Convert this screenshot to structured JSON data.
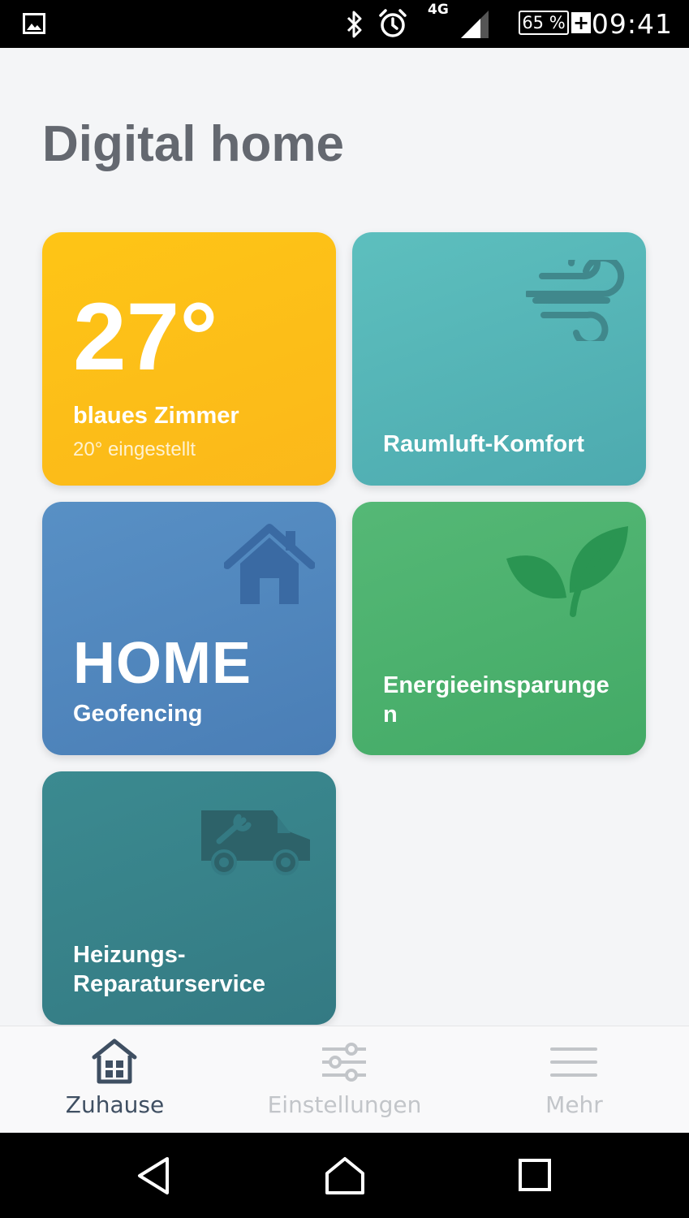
{
  "status_bar": {
    "network": "4G",
    "battery": "65 %",
    "charging": "+",
    "time": "09:41",
    "icons": [
      "image-icon",
      "bluetooth-icon",
      "alarm-icon",
      "signal-icon",
      "battery-icon"
    ]
  },
  "page": {
    "title": "Digital home"
  },
  "tiles": {
    "temperature": {
      "value": "27°",
      "room": "blaues Zimmer",
      "set_point": "20° eingestellt",
      "color": "#fcbf18"
    },
    "air": {
      "label": "Raumluft-Komfort",
      "icon": "wind-icon",
      "color": "#55b5b7"
    },
    "home": {
      "big": "HOME",
      "label": "Geofencing",
      "icon": "house-icon",
      "color": "#5088bd"
    },
    "energy": {
      "label": "Energieeinsparungen",
      "icon": "leaf-icon",
      "color": "#4cb16e"
    },
    "repair": {
      "label": "Heizungs-Reparaturservice",
      "icon": "repair-van-icon",
      "color": "#388289"
    }
  },
  "bottom_nav": {
    "items": [
      {
        "label": "Zuhause",
        "icon": "home-grid-icon",
        "active": true
      },
      {
        "label": "Einstellungen",
        "icon": "sliders-icon",
        "active": false
      },
      {
        "label": "Mehr",
        "icon": "menu-icon",
        "active": false
      }
    ]
  },
  "system_nav": {
    "icons": [
      "back-icon",
      "home-icon",
      "recents-icon"
    ]
  }
}
